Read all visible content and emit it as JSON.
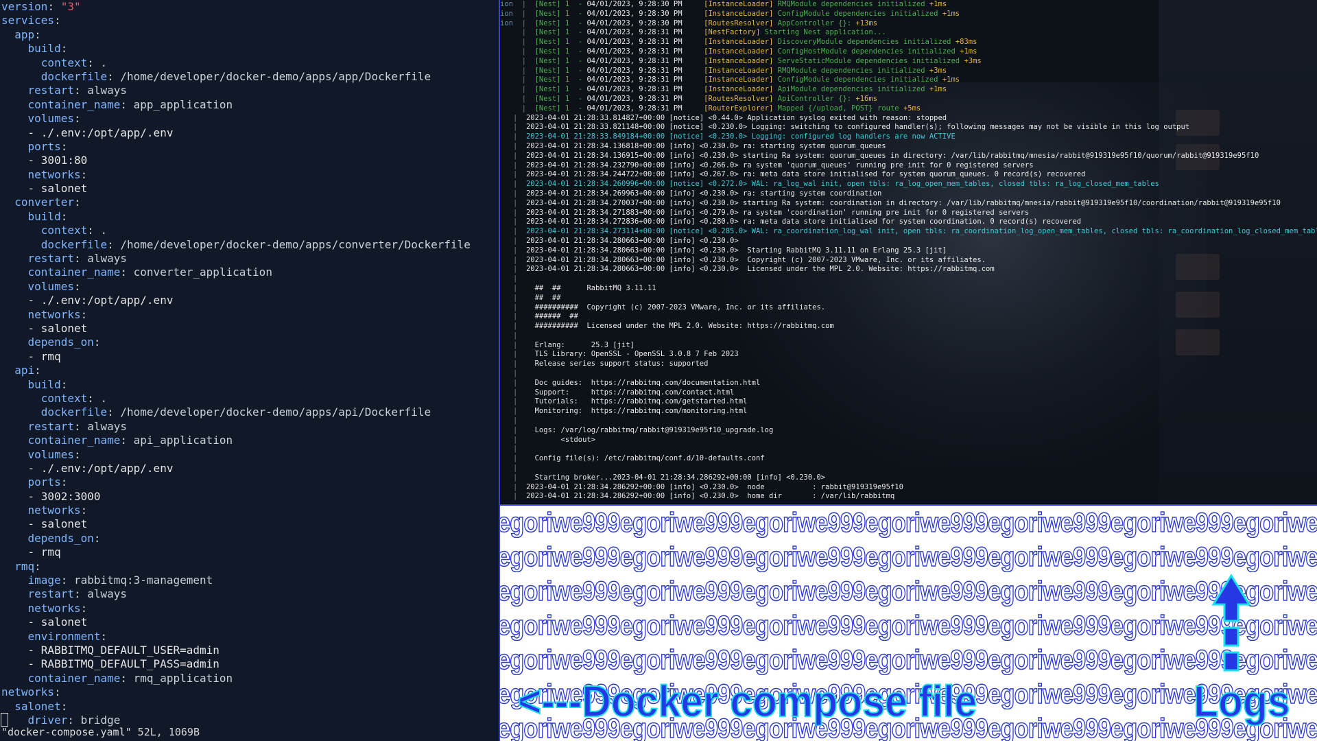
{
  "editor": {
    "lines": [
      [
        [
          "version",
          "key"
        ],
        [
          ": ",
          "punct"
        ],
        [
          "\"3\"",
          "str"
        ]
      ],
      [
        [
          "services",
          "key"
        ],
        [
          ":",
          "punct"
        ]
      ],
      [
        [
          "  app",
          "key"
        ],
        [
          ":",
          "punct"
        ]
      ],
      [
        [
          "    build",
          "key"
        ],
        [
          ":",
          "punct"
        ]
      ],
      [
        [
          "      context",
          "key"
        ],
        [
          ": .",
          "punct"
        ]
      ],
      [
        [
          "      dockerfile",
          "key"
        ],
        [
          ": /home/developer/docker-demo/apps/app/Dockerfile",
          "punct"
        ]
      ],
      [
        [
          "    restart",
          "key"
        ],
        [
          ": always",
          "punct"
        ]
      ],
      [
        [
          "    container_name",
          "key"
        ],
        [
          ": app_application",
          "punct"
        ]
      ],
      [
        [
          "    volumes",
          "key"
        ],
        [
          ":",
          "punct"
        ]
      ],
      [
        [
          "    - ./.env:/opt/app/.env",
          "dash"
        ]
      ],
      [
        [
          "    ports",
          "key"
        ],
        [
          ":",
          "punct"
        ]
      ],
      [
        [
          "    - 3001:80",
          "dash"
        ]
      ],
      [
        [
          "    networks",
          "key"
        ],
        [
          ":",
          "punct"
        ]
      ],
      [
        [
          "    - salonet",
          "dash"
        ]
      ],
      [
        [
          "  converter",
          "key"
        ],
        [
          ":",
          "punct"
        ]
      ],
      [
        [
          "    build",
          "key"
        ],
        [
          ":",
          "punct"
        ]
      ],
      [
        [
          "      context",
          "key"
        ],
        [
          ": .",
          "punct"
        ]
      ],
      [
        [
          "      dockerfile",
          "key"
        ],
        [
          ": /home/developer/docker-demo/apps/converter/Dockerfile",
          "punct"
        ]
      ],
      [
        [
          "    restart",
          "key"
        ],
        [
          ": always",
          "punct"
        ]
      ],
      [
        [
          "    container_name",
          "key"
        ],
        [
          ": converter_application",
          "punct"
        ]
      ],
      [
        [
          "    volumes",
          "key"
        ],
        [
          ":",
          "punct"
        ]
      ],
      [
        [
          "    - ./.env:/opt/app/.env",
          "dash"
        ]
      ],
      [
        [
          "    networks",
          "key"
        ],
        [
          ":",
          "punct"
        ]
      ],
      [
        [
          "    - salonet",
          "dash"
        ]
      ],
      [
        [
          "    depends_on",
          "key"
        ],
        [
          ":",
          "punct"
        ]
      ],
      [
        [
          "    - rmq",
          "dash"
        ]
      ],
      [
        [
          "  api",
          "key"
        ],
        [
          ":",
          "punct"
        ]
      ],
      [
        [
          "    build",
          "key"
        ],
        [
          ":",
          "punct"
        ]
      ],
      [
        [
          "      context",
          "key"
        ],
        [
          ": .",
          "punct"
        ]
      ],
      [
        [
          "      dockerfile",
          "key"
        ],
        [
          ": /home/developer/docker-demo/apps/api/Dockerfile",
          "punct"
        ]
      ],
      [
        [
          "    restart",
          "key"
        ],
        [
          ": always",
          "punct"
        ]
      ],
      [
        [
          "    container_name",
          "key"
        ],
        [
          ": api_application",
          "punct"
        ]
      ],
      [
        [
          "    volumes",
          "key"
        ],
        [
          ":",
          "punct"
        ]
      ],
      [
        [
          "    - ./.env:/opt/app/.env",
          "dash"
        ]
      ],
      [
        [
          "    ports",
          "key"
        ],
        [
          ":",
          "punct"
        ]
      ],
      [
        [
          "    - 3002:3000",
          "dash"
        ]
      ],
      [
        [
          "    networks",
          "key"
        ],
        [
          ":",
          "punct"
        ]
      ],
      [
        [
          "    - salonet",
          "dash"
        ]
      ],
      [
        [
          "    depends_on",
          "key"
        ],
        [
          ":",
          "punct"
        ]
      ],
      [
        [
          "    - rmq",
          "dash"
        ]
      ],
      [
        [
          "  rmq",
          "key"
        ],
        [
          ":",
          "punct"
        ]
      ],
      [
        [
          "    image",
          "key"
        ],
        [
          ": rabbitmq:3-management",
          "punct"
        ]
      ],
      [
        [
          "    restart",
          "key"
        ],
        [
          ": always",
          "punct"
        ]
      ],
      [
        [
          "    networks",
          "key"
        ],
        [
          ":",
          "punct"
        ]
      ],
      [
        [
          "    - salonet",
          "dash"
        ]
      ],
      [
        [
          "    environment",
          "key"
        ],
        [
          ":",
          "punct"
        ]
      ],
      [
        [
          "    - RABBITMQ_DEFAULT_USER=admin",
          "dash"
        ]
      ],
      [
        [
          "    - RABBITMQ_DEFAULT_PASS=admin",
          "dash"
        ]
      ],
      [
        [
          "    container_name",
          "key"
        ],
        [
          ": rmq_application",
          "punct"
        ]
      ],
      [
        [
          "networks",
          "key"
        ],
        [
          ":",
          "punct"
        ]
      ],
      [
        [
          "  salonet",
          "key"
        ],
        [
          ":",
          "punct"
        ]
      ],
      [
        [
          "    driver",
          "key"
        ],
        [
          ": bridge",
          "punct"
        ]
      ]
    ],
    "status_line": "\"docker-compose.yaml\" 52L, 1069B"
  },
  "logs": {
    "nest_lines": [
      {
        "pre": "ion",
        "date": "04/01/2023, 9:28:30 PM",
        "ctx": "[InstanceLoader]",
        "msg": "RMQModule dependencies initialized",
        "ms": "+1ms"
      },
      {
        "pre": "ion",
        "date": "04/01/2023, 9:28:30 PM",
        "ctx": "[InstanceLoader]",
        "msg": "ConfigModule dependencies initialized",
        "ms": "+1ms"
      },
      {
        "pre": "ion",
        "date": "04/01/2023, 9:28:30 PM",
        "ctx": "[RoutesResolver]",
        "msg": "AppController {}:",
        "ms": "+13ms"
      },
      {
        "pre": "",
        "date": "04/01/2023, 9:28:31 PM",
        "ctx": "[NestFactory]",
        "msg": "Starting Nest application...",
        "ms": ""
      },
      {
        "pre": "",
        "date": "04/01/2023, 9:28:31 PM",
        "ctx": "[InstanceLoader]",
        "msg": "DiscoveryModule dependencies initialized",
        "ms": "+83ms"
      },
      {
        "pre": "",
        "date": "04/01/2023, 9:28:31 PM",
        "ctx": "[InstanceLoader]",
        "msg": "ConfigHostModule dependencies initialized",
        "ms": "+1ms"
      },
      {
        "pre": "",
        "date": "04/01/2023, 9:28:31 PM",
        "ctx": "[InstanceLoader]",
        "msg": "ServeStaticModule dependencies initialized",
        "ms": "+3ms"
      },
      {
        "pre": "",
        "date": "04/01/2023, 9:28:31 PM",
        "ctx": "[InstanceLoader]",
        "msg": "RMQModule dependencies initialized",
        "ms": "+3ms"
      },
      {
        "pre": "",
        "date": "04/01/2023, 9:28:31 PM",
        "ctx": "[InstanceLoader]",
        "msg": "ConfigModule dependencies initialized",
        "ms": "+1ms"
      },
      {
        "pre": "",
        "date": "04/01/2023, 9:28:31 PM",
        "ctx": "[InstanceLoader]",
        "msg": "ApiModule dependencies initialized",
        "ms": "+1ms"
      },
      {
        "pre": "",
        "date": "04/01/2023, 9:28:31 PM",
        "ctx": "[RoutesResolver]",
        "msg": "ApiController {}:",
        "ms": "+16ms"
      },
      {
        "pre": "",
        "date": "04/01/2023, 9:28:31 PM",
        "ctx": "[RouterExplorer]",
        "msg": "Mapped {/upload, POST} route",
        "ms": "+5ms"
      }
    ],
    "nest_label": "[Nest] 1",
    "rabbit_lines": [
      {
        "t": "2023-04-01 21:28:33.814827+00:00 [notice] <0.44.0> Application syslog exited with reason: stopped",
        "c": "white"
      },
      {
        "t": "2023-04-01 21:28:33.821148+00:00 [notice] <0.230.0> Logging: switching to configured handler(s); following messages may not be visible in this log output",
        "c": "white"
      },
      {
        "t": "2023-04-01 21:28:33.849184+00:00 [notice] <0.230.0> Logging: configured log handlers are now ACTIVE",
        "c": "cyan"
      },
      {
        "t": "2023-04-01 21:28:34.136818+00:00 [info] <0.230.0> ra: starting system quorum_queues",
        "c": "white"
      },
      {
        "t": "2023-04-01 21:28:34.136915+00:00 [info] <0.230.0> starting Ra system: quorum_queues in directory: /var/lib/rabbitmq/mnesia/rabbit@919319e95f10/quorum/rabbit@919319e95f10",
        "c": "white"
      },
      {
        "t": "2023-04-01 21:28:34.232790+00:00 [info] <0.266.0> ra system 'quorum_queues' running pre init for 0 registered servers",
        "c": "white"
      },
      {
        "t": "2023-04-01 21:28:34.244722+00:00 [info] <0.267.0> ra: meta data store initialised for system quorum_queues. 0 record(s) recovered",
        "c": "white"
      },
      {
        "t": "2023-04-01 21:28:34.260996+00:00 [notice] <0.272.0> WAL: ra_log_wal init, open tbls: ra_log_open_mem_tables, closed tbls: ra_log_closed_mem_tables",
        "c": "cyan"
      },
      {
        "t": "2023-04-01 21:28:34.269963+00:00 [info] <0.230.0> ra: starting system coordination",
        "c": "white"
      },
      {
        "t": "2023-04-01 21:28:34.270037+00:00 [info] <0.230.0> starting Ra system: coordination in directory: /var/lib/rabbitmq/mnesia/rabbit@919319e95f10/coordination/rabbit@919319e95f10",
        "c": "white"
      },
      {
        "t": "2023-04-01 21:28:34.271883+00:00 [info] <0.279.0> ra system 'coordination' running pre init for 0 registered servers",
        "c": "white"
      },
      {
        "t": "2023-04-01 21:28:34.272836+00:00 [info] <0.280.0> ra: meta data store initialised for system coordination. 0 record(s) recovered",
        "c": "white"
      },
      {
        "t": "2023-04-01 21:28:34.273114+00:00 [notice] <0.285.0> WAL: ra_coordination_log_wal init, open tbls: ra_coordination_log_open_mem_tables, closed tbls: ra_coordination_log_closed_mem_tables",
        "c": "cyan"
      },
      {
        "t": "2023-04-01 21:28:34.280663+00:00 [info] <0.230.0>",
        "c": "white"
      },
      {
        "t": "2023-04-01 21:28:34.280663+00:00 [info] <0.230.0>  Starting RabbitMQ 3.11.11 on Erlang 25.3 [jit]",
        "c": "white"
      },
      {
        "t": "2023-04-01 21:28:34.280663+00:00 [info] <0.230.0>  Copyright (c) 2007-2023 VMware, Inc. or its affiliates.",
        "c": "white"
      },
      {
        "t": "2023-04-01 21:28:34.280663+00:00 [info] <0.230.0>  Licensed under the MPL 2.0. Website: https://rabbitmq.com",
        "c": "white"
      },
      {
        "t": "",
        "c": "white"
      },
      {
        "t": "  ##  ##      RabbitMQ 3.11.11",
        "c": "white"
      },
      {
        "t": "  ##  ##",
        "c": "white"
      },
      {
        "t": "  ##########  Copyright (c) 2007-2023 VMware, Inc. or its affiliates.",
        "c": "white"
      },
      {
        "t": "  ######  ##",
        "c": "white"
      },
      {
        "t": "  ##########  Licensed under the MPL 2.0. Website: https://rabbitmq.com",
        "c": "white"
      },
      {
        "t": "",
        "c": "white"
      },
      {
        "t": "  Erlang:      25.3 [jit]",
        "c": "white"
      },
      {
        "t": "  TLS Library: OpenSSL - OpenSSL 3.0.8 7 Feb 2023",
        "c": "white"
      },
      {
        "t": "  Release series support status: supported",
        "c": "white"
      },
      {
        "t": "",
        "c": "white"
      },
      {
        "t": "  Doc guides:  https://rabbitmq.com/documentation.html",
        "c": "white"
      },
      {
        "t": "  Support:     https://rabbitmq.com/contact.html",
        "c": "white"
      },
      {
        "t": "  Tutorials:   https://rabbitmq.com/getstarted.html",
        "c": "white"
      },
      {
        "t": "  Monitoring:  https://rabbitmq.com/monitoring.html",
        "c": "white"
      },
      {
        "t": "",
        "c": "white"
      },
      {
        "t": "  Logs: /var/log/rabbitmq/rabbit@919319e95f10_upgrade.log",
        "c": "white"
      },
      {
        "t": "        <stdout>",
        "c": "white"
      },
      {
        "t": "",
        "c": "white"
      },
      {
        "t": "  Config file(s): /etc/rabbitmq/conf.d/10-defaults.conf",
        "c": "white"
      },
      {
        "t": "",
        "c": "white"
      },
      {
        "t": "  Starting broker...2023-04-01 21:28:34.286292+00:00 [info] <0.230.0>",
        "c": "white"
      },
      {
        "t": "2023-04-01 21:28:34.286292+00:00 [info] <0.230.0>  node           : rabbit@919319e95f10",
        "c": "white"
      },
      {
        "t": "2023-04-01 21:28:34.286292+00:00 [info] <0.230.0>  home dir       : /var/lib/rabbitmq",
        "c": "white"
      }
    ]
  },
  "banner": {
    "watermark_row": "egoriwe999egoriwe999egoriwe999egoriwe999egoriwe999egoriwe999egoriwe999egoriwe999",
    "caption_compose": "<---Docker compose file",
    "caption_logs": "Logs"
  },
  "colors": {
    "editor_bg": "#111827",
    "yaml_key": "#7fb6ff",
    "yaml_string": "#e35d6a",
    "nest_green": "#4caf50",
    "nest_yellow": "#e5b842",
    "log_cyan": "#3ec9d6",
    "caption_blue": "#2637e6",
    "caption_outline": "#16e0ea",
    "divider": "#3a3fd6"
  },
  "icons": [
    "up-arrow-icon"
  ]
}
